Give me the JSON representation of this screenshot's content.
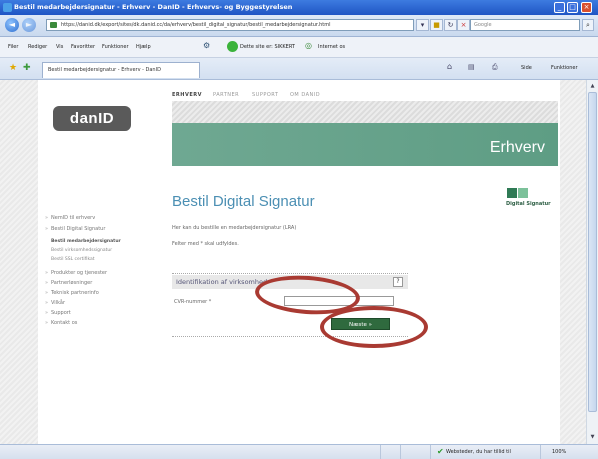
{
  "window": {
    "title": "Bestil medarbejdersignatur - Erhverv - DanID - Erhvervs- og Byggestyrelsen",
    "minimize": "_",
    "maximize": "□",
    "close": "×"
  },
  "browser": {
    "back": "◄",
    "forward": "►",
    "address": "https://danid.dk/export/sites/dk.danid.cc/da/erhverv/bestil_digital_signatur/bestil_medarbejdersignatur.html",
    "refresh": "↻",
    "stop": "×",
    "search_placeholder": "Google",
    "search_button": "⌕",
    "menu": [
      "Filer",
      "Rediger",
      "Vis",
      "Favoritter",
      "Funktioner",
      "Hjælp"
    ],
    "security_text": "Dette site er: SIKKERT",
    "network_text": "Internet os",
    "tab_title": "Bestil medarbejdersignatur - Erhverv - DanID",
    "favorites_star": "★",
    "add_favorite": "✚",
    "commands": [
      "Side",
      "Funktioner"
    ],
    "status_zone": "Websteder, du har tillid til",
    "zoom": "100%",
    "check_glyph": "✔"
  },
  "site": {
    "logo": "danID",
    "topnav": [
      "ERHVERV",
      "PARTNER",
      "SUPPORT",
      "OM DANID"
    ],
    "banner_label": "Erhverv",
    "heading": "Bestil Digital Signatur",
    "ds_logo_text": "Digital Signatur",
    "sidenav": [
      "NemID til erhverv",
      "Bestil Digital Signatur",
      "Produkter og tjenester",
      "Partnerløsninger",
      "Teknisk partnerinfo",
      "Vilkår",
      "Support",
      "Kontakt os"
    ],
    "subnav": [
      "Bestil medarbejdersignatur",
      "Bestil virksomhedssignatur",
      "Bestil SSL certifikat"
    ],
    "intro": "Her kan du bestille en medarbejdersignatur (LRA)",
    "required_note": "Felter med * skal udfyldes.",
    "form_title": "Identifikation af virksomhed",
    "help": "?",
    "cvr_label": "CVR-nummer *",
    "cvr_value": "",
    "next_button": "Næste »",
    "bullet": "»"
  },
  "colors": {
    "banner": "#6fa892",
    "heading": "#4b8fb3",
    "next_button": "#2f6a3e",
    "highlight": "#a93a32"
  }
}
